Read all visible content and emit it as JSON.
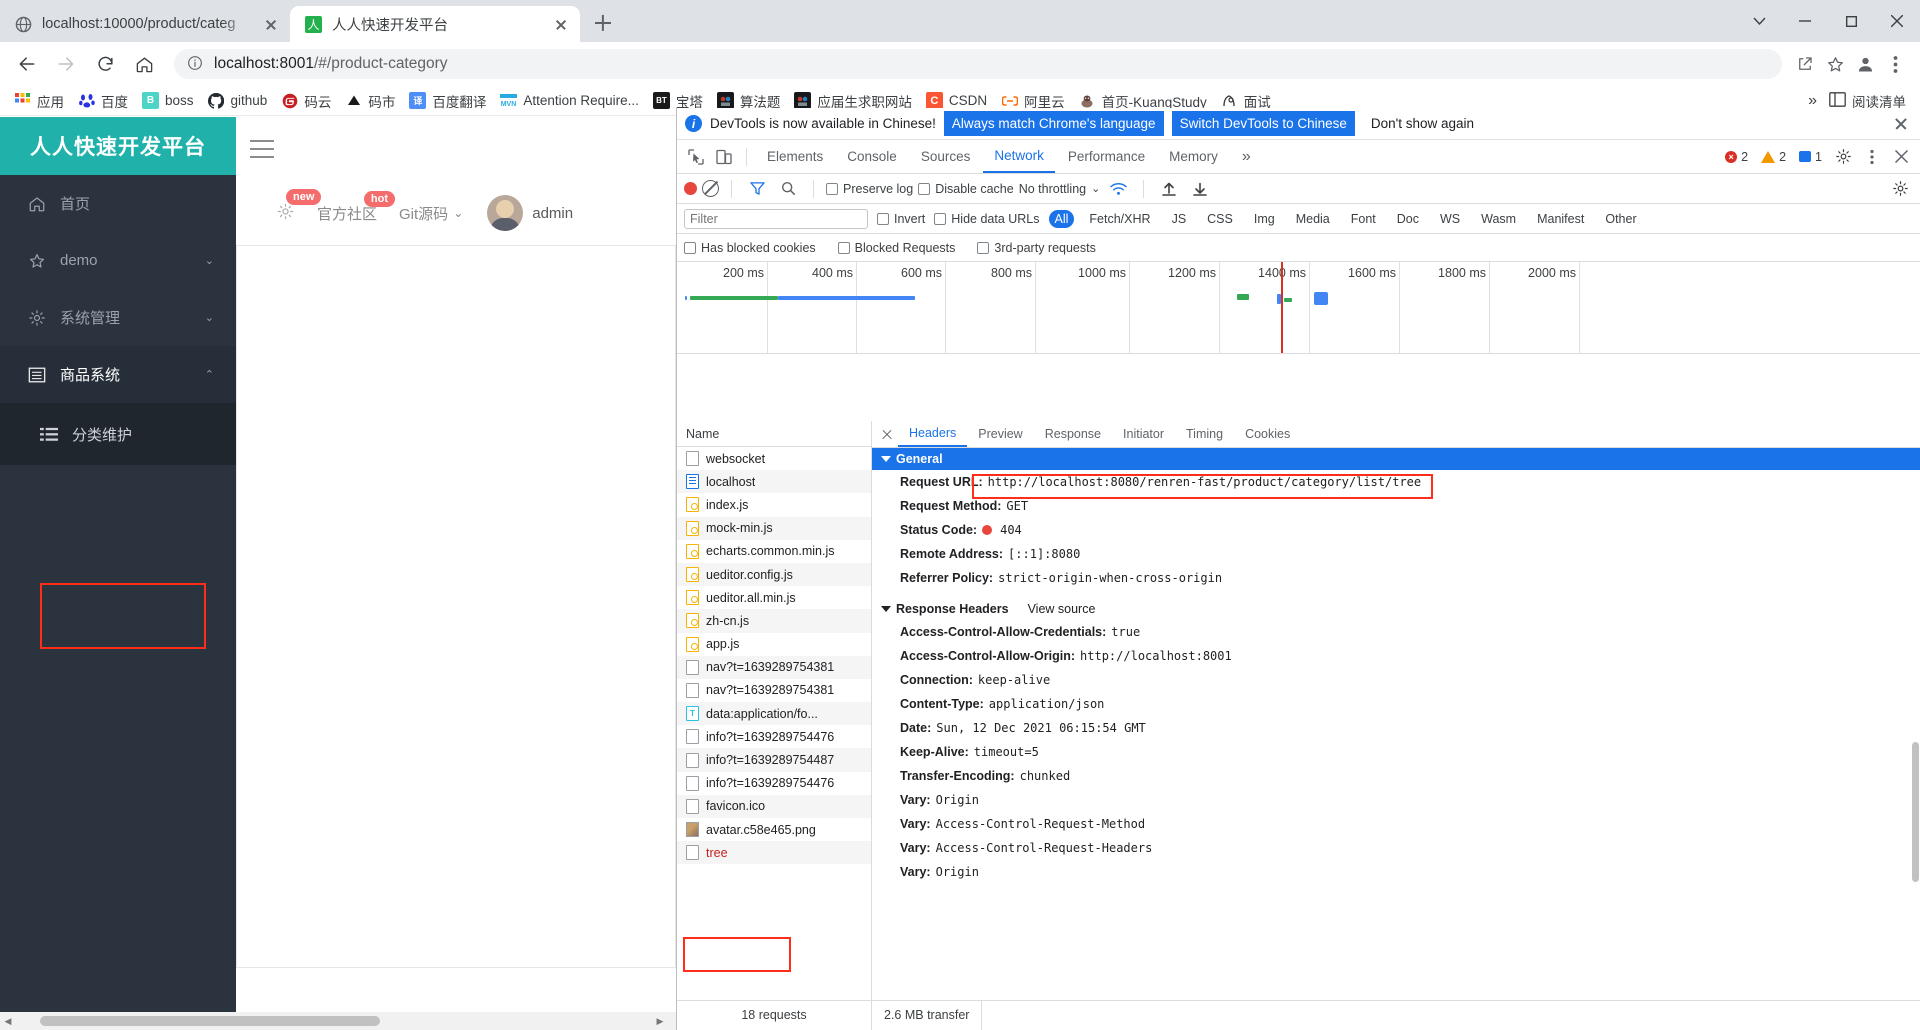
{
  "browser": {
    "tabs": [
      {
        "title": "localhost:10000/product/categ",
        "favicon": "globe-icon",
        "active": false
      },
      {
        "title": "人人快速开发平台",
        "favicon": "renren-icon",
        "active": true
      }
    ],
    "new_tab_label": "+",
    "window_controls": {
      "minimize": "‒",
      "maximize": "☐",
      "close": "✕",
      "more_tabs": "∨"
    },
    "omnibox": {
      "host": "localhost:8001",
      "path": "/#/product-category",
      "full_url": "localhost:8001/#/product-category",
      "info_icon": "info-circle-icon"
    },
    "nav": {
      "back": "←",
      "forward": "→",
      "reload": "⟳",
      "home": "⌂"
    },
    "toolbar_icons": [
      "share-icon",
      "star-icon",
      "profile-icon",
      "menu-dots-icon"
    ],
    "bookmarks": [
      {
        "label": "应用",
        "icon": "apps-grid-icon"
      },
      {
        "label": "百度",
        "icon": "baidu-icon"
      },
      {
        "label": "boss",
        "icon": "boss-icon"
      },
      {
        "label": "github",
        "icon": "github-icon"
      },
      {
        "label": "码云",
        "icon": "gitee-icon"
      },
      {
        "label": "码市",
        "icon": "mashi-icon"
      },
      {
        "label": "百度翻译",
        "icon": "fanyi-icon"
      },
      {
        "label": "Attention Require...",
        "icon": "mvn-icon"
      },
      {
        "label": "宝塔",
        "icon": "bt-icon"
      },
      {
        "label": "算法题",
        "icon": "suanfa-icon"
      },
      {
        "label": "应届生求职网站",
        "icon": "yingjie-icon"
      },
      {
        "label": "CSDN",
        "icon": "csdn-icon"
      },
      {
        "label": "阿里云",
        "icon": "aliyun-icon"
      },
      {
        "label": "首页-KuangStudy",
        "icon": "kuangstudy-icon"
      },
      {
        "label": "面试",
        "icon": "mianshi-icon"
      }
    ],
    "overflow_label": "»",
    "reading_list_label": "阅读清单",
    "reading_list_icon": "reading-list-icon"
  },
  "app": {
    "logo": "人人快速开发平台",
    "menu": [
      {
        "label": "首页",
        "icon": "home-icon",
        "chevron": ""
      },
      {
        "label": "demo",
        "icon": "star-icon",
        "chevron": "⌄"
      },
      {
        "label": "系统管理",
        "icon": "gear-icon",
        "chevron": "⌄"
      },
      {
        "label": "商品系统",
        "icon": "catalog-icon",
        "chevron": "⌃"
      }
    ],
    "submenu": [
      {
        "label": "分类维护",
        "icon": "list-icon"
      }
    ],
    "header": {
      "hamburger": "menu-icon",
      "gear_badge": "new",
      "community_label": "官方社区",
      "community_badge": "hot",
      "git_label": "Git源码",
      "git_chevron": "⌄",
      "user_label": "admin",
      "avatar": "user-avatar"
    }
  },
  "devtools": {
    "notice": {
      "icon": "info-icon",
      "text": "DevTools is now available in Chinese!",
      "primary_button": "Always match Chrome's language",
      "secondary_button": "Switch DevTools to Chinese",
      "dismiss_button": "Don't show again",
      "close_icon": "close-icon"
    },
    "tabs": [
      {
        "label": "Elements",
        "active": false
      },
      {
        "label": "Console",
        "active": false
      },
      {
        "label": "Sources",
        "active": false
      },
      {
        "label": "Network",
        "active": true
      },
      {
        "label": "Performance",
        "active": false
      },
      {
        "label": "Memory",
        "active": false
      }
    ],
    "tabs_overflow": "»",
    "inspect_icon": "cursor-select-icon",
    "device_icon": "device-toolbar-icon",
    "counters": {
      "errors": "2",
      "warnings": "2",
      "messages": "1"
    },
    "settings_icon": "gear-icon",
    "more_icon": "kebab-menu-icon",
    "close_icon": "close-icon",
    "toolbar": {
      "record_icon": "record-red-dot",
      "clear_icon": "clear-icon",
      "filter_icon": "funnel-icon",
      "search_icon": "search-icon",
      "preserve_log": "Preserve log",
      "disable_cache": "Disable cache",
      "throttling": "No throttling",
      "throttle_chevron": "⌄",
      "wifi_icon": "wifi-icon",
      "import_icon": "upload-arrow-icon",
      "export_icon": "download-arrow-icon",
      "network_settings_icon": "gear-icon"
    },
    "filterbar": {
      "filter_placeholder": "Filter",
      "filter_value": "",
      "invert": "Invert",
      "hide_data_urls": "Hide data URLs",
      "types": [
        "All",
        "Fetch/XHR",
        "JS",
        "CSS",
        "Img",
        "Media",
        "Font",
        "Doc",
        "WS",
        "Wasm",
        "Manifest",
        "Other"
      ],
      "selected_type": "All",
      "has_blocked_cookies": "Has blocked cookies",
      "blocked_requests": "Blocked Requests",
      "third_party": "3rd-party requests"
    },
    "overview_ticks": [
      "200 ms",
      "400 ms",
      "600 ms",
      "800 ms",
      "1000 ms",
      "1200 ms",
      "1400 ms",
      "1600 ms",
      "1800 ms",
      "2000 ms"
    ],
    "requests_header": "Name",
    "requests": [
      {
        "name": "websocket",
        "icon": "other"
      },
      {
        "name": "localhost",
        "icon": "doc"
      },
      {
        "name": "index.js",
        "icon": "js"
      },
      {
        "name": "mock-min.js",
        "icon": "js"
      },
      {
        "name": "echarts.common.min.js",
        "icon": "js"
      },
      {
        "name": "ueditor.config.js",
        "icon": "js"
      },
      {
        "name": "ueditor.all.min.js",
        "icon": "js"
      },
      {
        "name": "zh-cn.js",
        "icon": "js"
      },
      {
        "name": "app.js",
        "icon": "js"
      },
      {
        "name": "nav?t=1639289754381",
        "icon": "other"
      },
      {
        "name": "nav?t=1639289754381",
        "icon": "other"
      },
      {
        "name": "data:application/fo...",
        "icon": "txt"
      },
      {
        "name": "info?t=1639289754476",
        "icon": "other"
      },
      {
        "name": "info?t=1639289754487",
        "icon": "other"
      },
      {
        "name": "info?t=1639289754476",
        "icon": "other"
      },
      {
        "name": "favicon.ico",
        "icon": "other"
      },
      {
        "name": "avatar.c58e465.png",
        "icon": "img"
      },
      {
        "name": "tree",
        "icon": "other",
        "highlighted": true
      }
    ],
    "detail_tabs": [
      {
        "label": "Headers",
        "active": true
      },
      {
        "label": "Preview",
        "active": false
      },
      {
        "label": "Response",
        "active": false
      },
      {
        "label": "Initiator",
        "active": false
      },
      {
        "label": "Timing",
        "active": false
      },
      {
        "label": "Cookies",
        "active": false
      }
    ],
    "general_section": {
      "title": "General",
      "rows": [
        {
          "key": "Request URL:",
          "value": "http://localhost:8080/renren-fast/product/category/list/tree",
          "highlighted": true
        },
        {
          "key": "Request Method:",
          "value": "GET"
        },
        {
          "key": "Status Code:",
          "value": "404",
          "status_dot": true
        },
        {
          "key": "Remote Address:",
          "value": "[::1]:8080"
        },
        {
          "key": "Referrer Policy:",
          "value": "strict-origin-when-cross-origin"
        }
      ]
    },
    "response_section": {
      "title": "Response Headers",
      "view_source": "View source",
      "rows": [
        {
          "key": "Access-Control-Allow-Credentials:",
          "value": "true"
        },
        {
          "key": "Access-Control-Allow-Origin:",
          "value": "http://localhost:8001"
        },
        {
          "key": "Connection:",
          "value": "keep-alive"
        },
        {
          "key": "Content-Type:",
          "value": "application/json"
        },
        {
          "key": "Date:",
          "value": "Sun, 12 Dec 2021 06:15:54 GMT"
        },
        {
          "key": "Keep-Alive:",
          "value": "timeout=5"
        },
        {
          "key": "Transfer-Encoding:",
          "value": "chunked"
        },
        {
          "key": "Vary:",
          "value": "Origin"
        },
        {
          "key": "Vary:",
          "value": "Access-Control-Request-Method"
        },
        {
          "key": "Vary:",
          "value": "Access-Control-Request-Headers"
        },
        {
          "key": "Vary:",
          "value": "Origin"
        }
      ]
    },
    "statusbar": {
      "requests": "18 requests",
      "transfer": "2.6 MB transfer"
    }
  },
  "colors": {
    "accent_blue": "#1a73e8",
    "app_teal": "#20b2aa",
    "sidebar_dark": "#2b333e",
    "error_red": "#d93025",
    "highlight_red": "#ff2d1a",
    "badge_red": "#f56c6c"
  }
}
